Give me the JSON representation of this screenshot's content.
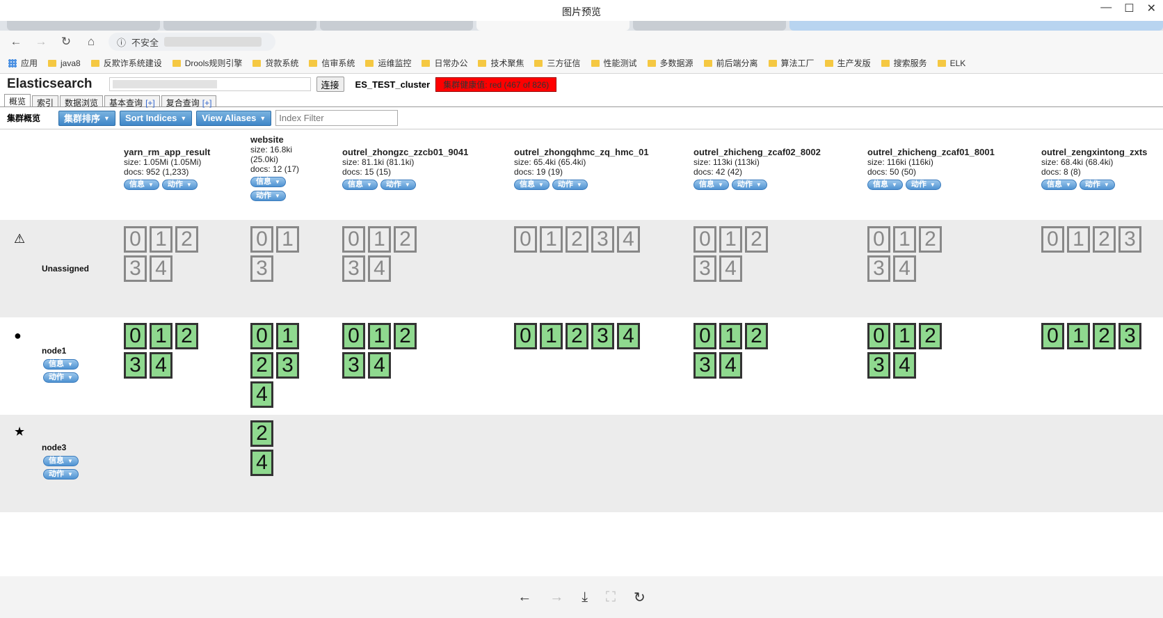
{
  "viewer": {
    "title": "图片预览",
    "window_buttons": [
      "—",
      "☐",
      "✕"
    ],
    "footer_icons": [
      "←",
      "→",
      "⤓",
      "⛶",
      "↻"
    ]
  },
  "browser": {
    "security_label": "不安全",
    "bookmarks": [
      "应用",
      "java8",
      "反欺诈系统建设",
      "Drools规则引擎",
      "贷款系统",
      "信审系统",
      "运维监控",
      "日常办公",
      "技术聚焦",
      "三方征信",
      "性能测试",
      "多数据源",
      "前后端分离",
      "算法工厂",
      "生产发版",
      "搜索服务",
      "ELK"
    ]
  },
  "es": {
    "logo": "Elasticsearch",
    "connect_label": "连接",
    "cluster_name": "ES_TEST_cluster",
    "health": "集群健康值: red (467 of 826)",
    "tabs": [
      {
        "label": "概览",
        "plus": ""
      },
      {
        "label": "索引",
        "plus": ""
      },
      {
        "label": "数据浏览",
        "plus": ""
      },
      {
        "label": "基本查询",
        "plus": "[+]"
      },
      {
        "label": "复合查询",
        "plus": "[+]"
      }
    ],
    "toolbar": {
      "label": "集群概览",
      "sort_cluster": "集群排序",
      "sort_indices": "Sort Indices",
      "view_aliases": "View Aliases",
      "filter_placeholder": "Index Filter"
    },
    "pill_info": "信息",
    "pill_action": "动作",
    "indices": [
      {
        "name": "yarn_rm_app_result",
        "size": "size: 1.05Mi (1.05Mi)",
        "docs": "docs: 952 (1,233)",
        "unassigned": [
          "0",
          "1",
          "2",
          "3",
          "4"
        ],
        "node1": [
          "0",
          "1",
          "2",
          "3",
          "4"
        ],
        "node3": []
      },
      {
        "name": "website",
        "size": "size: 16.8ki",
        "size2": "(25.0ki)",
        "docs": "docs: 12 (17)",
        "unassigned": [
          "0",
          "1",
          "3"
        ],
        "node1": [
          "0",
          "1",
          "2",
          "3",
          "4"
        ],
        "node3": [
          "2",
          "4"
        ]
      },
      {
        "name": "outrel_zhongzc_zzcb01_9041",
        "size": "size: 81.1ki (81.1ki)",
        "docs": "docs: 15 (15)",
        "unassigned": [
          "0",
          "1",
          "2",
          "3",
          "4"
        ],
        "node1": [
          "0",
          "1",
          "2",
          "3",
          "4"
        ],
        "node3": []
      },
      {
        "name": "outrel_zhongqhmc_zq_hmc_01",
        "size": "size: 65.4ki (65.4ki)",
        "docs": "docs: 19 (19)",
        "unassigned": [
          "0",
          "1",
          "2",
          "3",
          "4"
        ],
        "node1": [
          "0",
          "1",
          "2",
          "3",
          "4"
        ],
        "node3": []
      },
      {
        "name": "outrel_zhicheng_zcaf02_8002",
        "size": "size: 113ki (113ki)",
        "docs": "docs: 42 (42)",
        "unassigned": [
          "0",
          "1",
          "2",
          "3",
          "4"
        ],
        "node1": [
          "0",
          "1",
          "2",
          "3",
          "4"
        ],
        "node3": []
      },
      {
        "name": "outrel_zhicheng_zcaf01_8001",
        "size": "size: 116ki (116ki)",
        "docs": "docs: 50 (50)",
        "unassigned": [
          "0",
          "1",
          "2",
          "3",
          "4"
        ],
        "node1": [
          "0",
          "1",
          "2",
          "3",
          "4"
        ],
        "node3": []
      },
      {
        "name": "outrel_zengxintong_zxts",
        "size": "size: 68.4ki (68.4ki)",
        "docs": "docs: 8 (8)",
        "unassigned": [
          "0",
          "1",
          "2",
          "3"
        ],
        "node1": [
          "0",
          "1",
          "2",
          "3"
        ],
        "node3": []
      }
    ],
    "rows": [
      {
        "label": "Unassigned",
        "icon": "⚠"
      },
      {
        "label": "node1",
        "icon": "●"
      },
      {
        "label": "node3",
        "icon": "★"
      }
    ]
  }
}
